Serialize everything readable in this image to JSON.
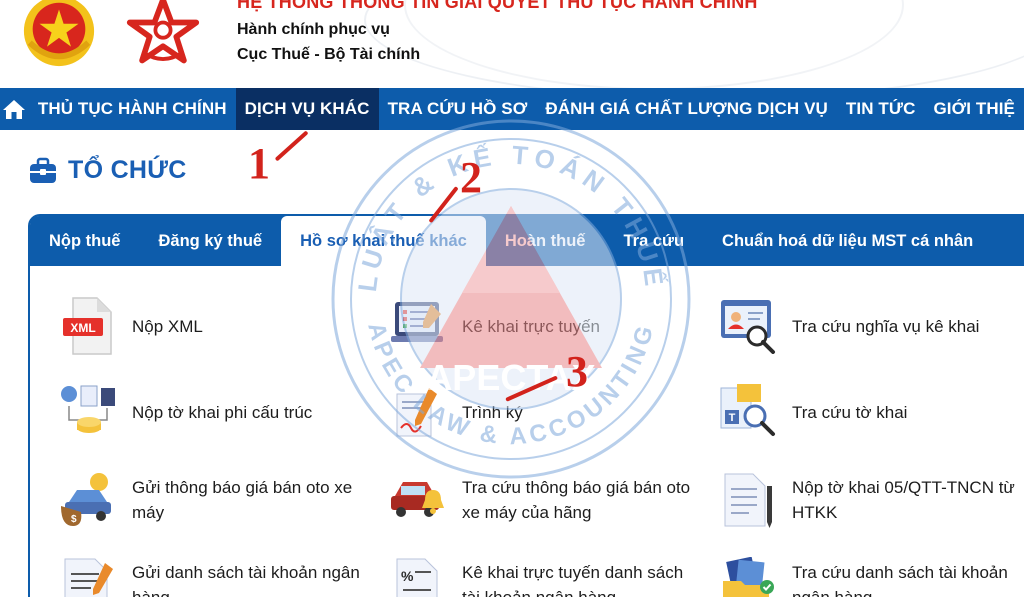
{
  "header": {
    "title": "HỆ THỐNG THÔNG TIN GIẢI QUYẾT THỦ TỤC HÀNH CHÍNH",
    "subtitle1": "Hành chính phục vụ",
    "subtitle2": "Cục Thuế - Bộ Tài chính"
  },
  "nav": {
    "items": [
      {
        "label": "THỦ TỤC HÀNH CHÍNH"
      },
      {
        "label": "DỊCH VỤ KHÁC",
        "active": true
      },
      {
        "label": "TRA CỨU HỒ SƠ"
      },
      {
        "label": "ĐÁNH GIÁ CHẤT LƯỢNG DỊCH VỤ"
      },
      {
        "label": "TIN TỨC"
      },
      {
        "label": "GIỚI THIỆ"
      }
    ]
  },
  "section": {
    "title": "TỔ CHỨC"
  },
  "tabs": [
    {
      "label": "Nộp thuế"
    },
    {
      "label": "Đăng ký thuế"
    },
    {
      "label": "Hồ sơ khai thuế khác",
      "active": true
    },
    {
      "label": "Hoàn thuế"
    },
    {
      "label": "Tra cứu"
    },
    {
      "label": "Chuẩn hoá dữ liệu MST cá nhân"
    }
  ],
  "services": [
    {
      "label": "Nộp XML",
      "icon": "xml-file-icon"
    },
    {
      "label": "Kê khai trực tuyến",
      "icon": "online-form-icon"
    },
    {
      "label": "Tra cứu nghĩa vụ kê khai",
      "icon": "id-card-search-icon"
    },
    {
      "label": "Nộp tờ khai phi cấu trúc",
      "icon": "unstructured-declaration-icon"
    },
    {
      "label": "Trình ký",
      "icon": "sign-document-icon"
    },
    {
      "label": "Tra cứu tờ khai",
      "icon": "document-search-icon"
    },
    {
      "label": "Gửi thông báo giá bán oto xe máy",
      "icon": "vehicle-price-icon"
    },
    {
      "label": "Tra cứu thông báo giá bán oto xe máy của hãng",
      "icon": "car-notification-icon"
    },
    {
      "label": "Nộp tờ khai 05/QTT-TNCN từ HTKK",
      "icon": "document-pen-icon"
    },
    {
      "label": "Gửi danh sách tài khoản ngân hàng",
      "icon": "document-list-icon"
    },
    {
      "label": "Kê khai trực tuyến danh sách tài khoản ngân hàng",
      "icon": "percent-document-icon"
    },
    {
      "label": "Tra cứu danh sách tài khoản ngân hàng",
      "icon": "folder-check-icon"
    }
  ],
  "watermark": {
    "brand": "APECTAX",
    "ring_top": "LUẬT & KẾ TOÁN THUẾ",
    "ring_bottom": "APEC LAW & ACCOUNTING"
  },
  "annotations": [
    "1",
    "2",
    "3"
  ],
  "colors": {
    "nav_blue": "#0d5cab",
    "nav_active": "#0a2f63",
    "title_red": "#d7261e",
    "accent_blue": "#1a5fb4",
    "annotation_red": "#d2231c"
  }
}
